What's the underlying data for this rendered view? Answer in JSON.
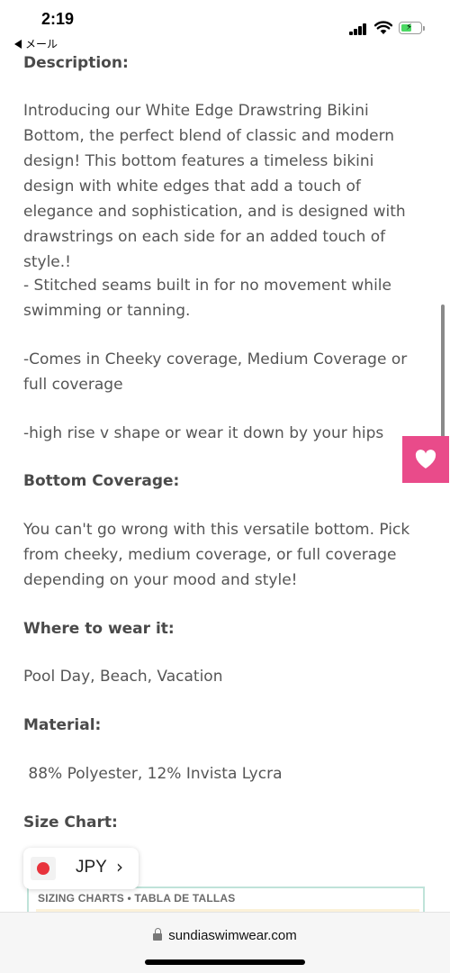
{
  "status_bar": {
    "time": "2:19",
    "back_app": "メール"
  },
  "product": {
    "description_heading": "Description:",
    "description_body": "Introducing our White Edge Drawstring Bikini Bottom, the perfect blend of classic and modern design! This bottom features a timeless bikini design with white edges that add a touch of elegance and sophistication, and is designed with drawstrings on each side for an added touch of style.!",
    "bullet_1": "- Stitched seams built in for no movement while swimming or tanning.",
    "bullet_2": "-Comes in Cheeky coverage, Medium Coverage or full coverage",
    "bullet_3": "-high rise v shape or wear it down by your hips",
    "coverage_heading": "Bottom Coverage:",
    "coverage_body": "You can't go wrong with this versatile bottom. Pick from cheeky, medium coverage, or full coverage depending on your mood and style!",
    "where_heading": "Where to wear it:",
    "where_body": "Pool Day, Beach, Vacation",
    "material_heading": "Material:",
    "material_body": " 88% Polyester, 12% Invista Lycra",
    "size_chart_heading": "Size Chart:"
  },
  "currency": {
    "code": "JPY",
    "chevron": "›"
  },
  "size_chart": {
    "title": "SIZING CHARTS • TABLA DE TALLAS"
  },
  "browser": {
    "url": "sundiaswimwear.com"
  },
  "colors": {
    "accent_pink": "#e94b8a",
    "text_gray": "#555555",
    "chart_border": "#bfe3d9"
  }
}
